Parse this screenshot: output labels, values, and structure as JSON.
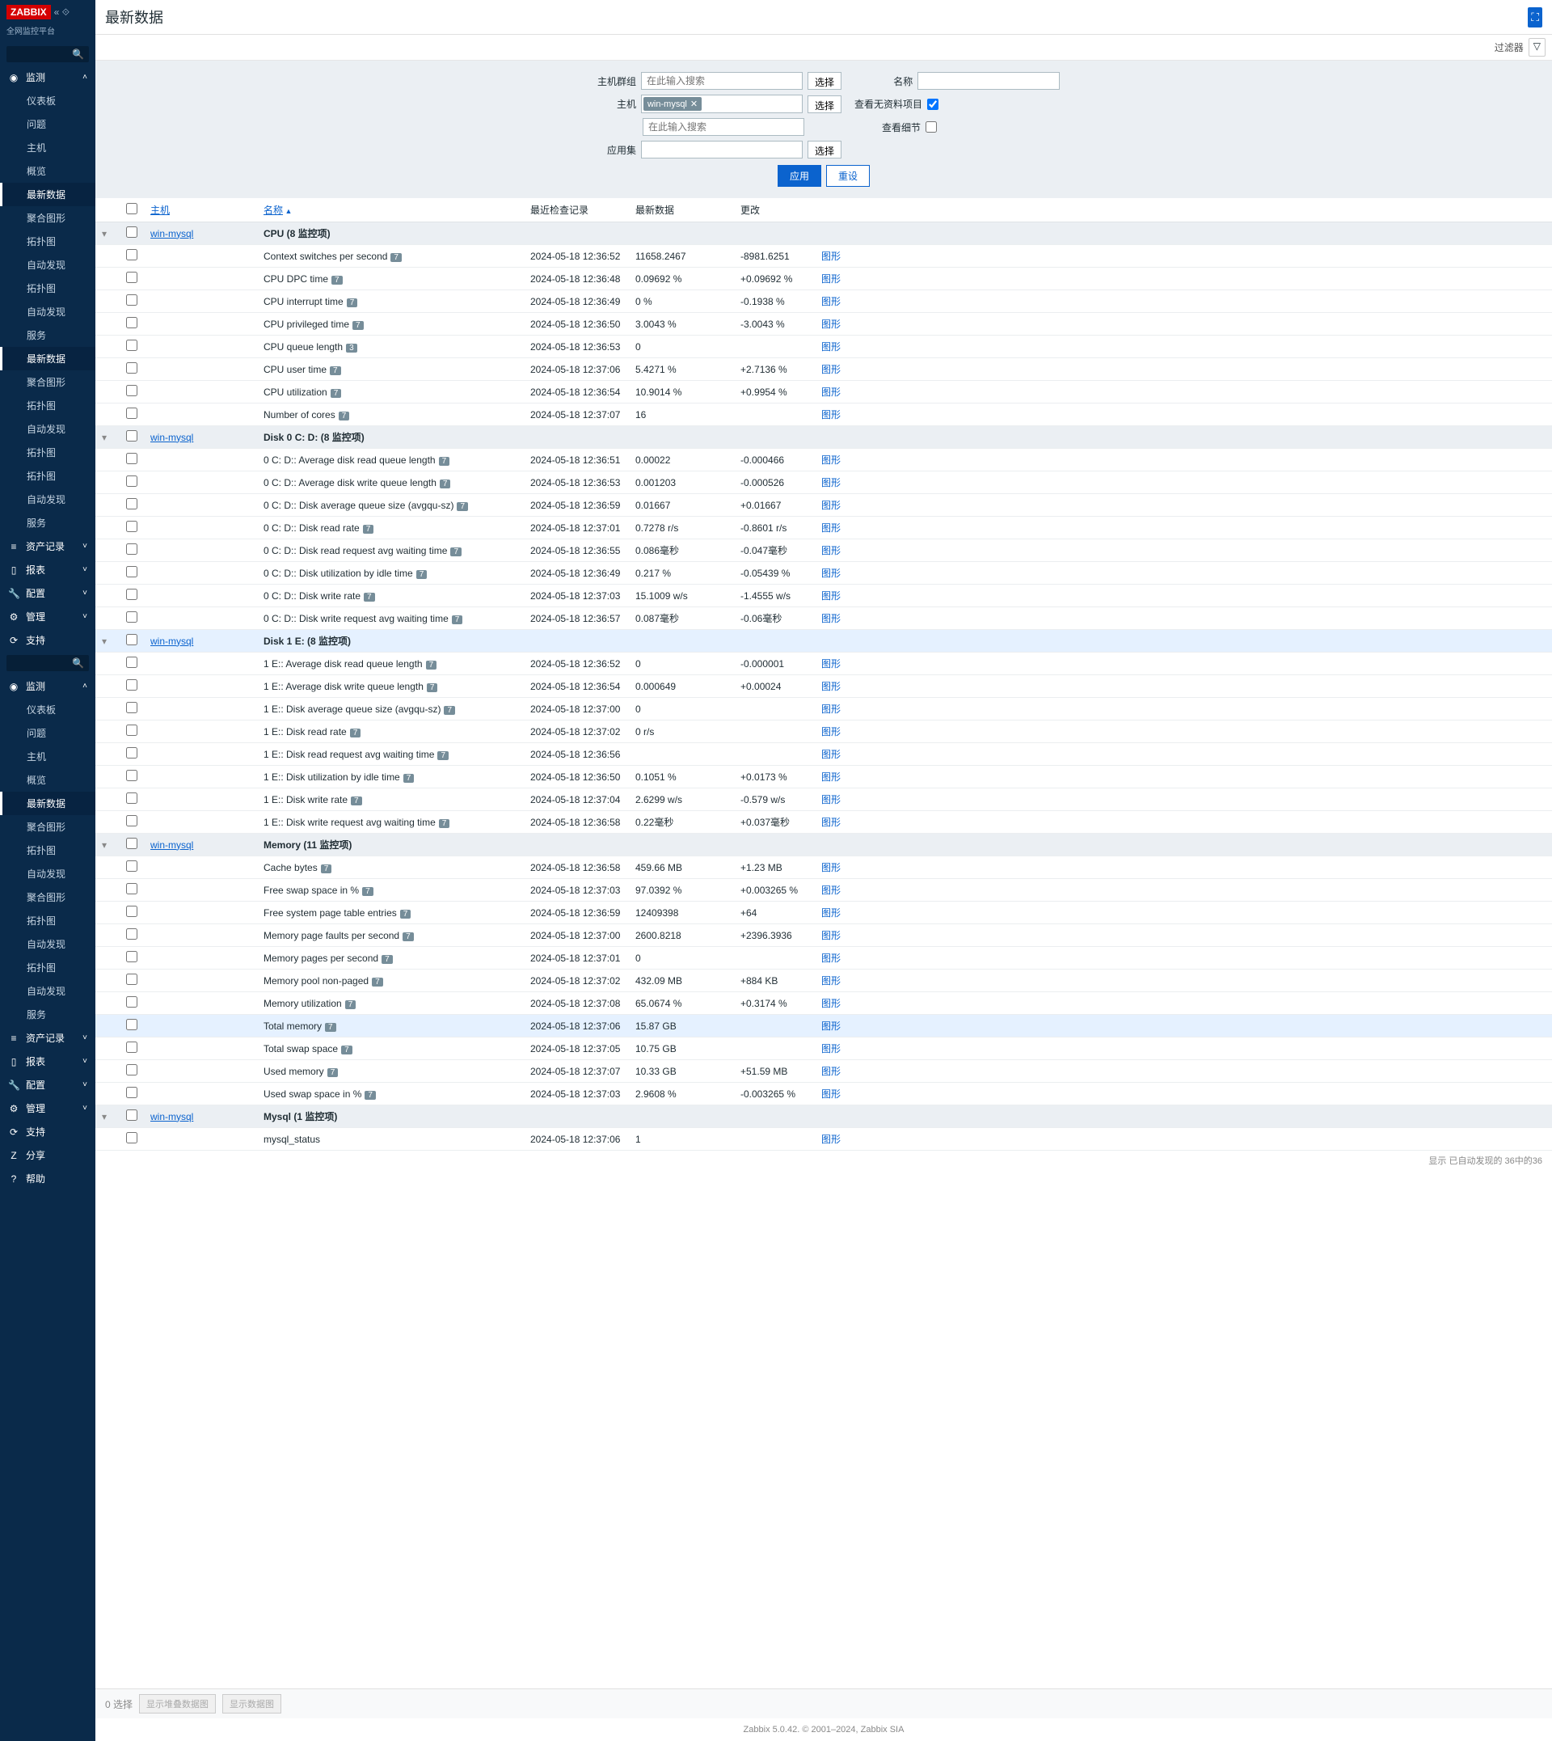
{
  "logo": "ZABBIX",
  "sublogo": "全网监控平台",
  "page_title": "最新数据",
  "filter_label": "过滤器",
  "nav": [
    {
      "type": "section",
      "icon": "◉",
      "label": "监测",
      "chev": "˄"
    },
    {
      "type": "item",
      "label": "仪表板"
    },
    {
      "type": "item",
      "label": "问题"
    },
    {
      "type": "item",
      "label": "主机"
    },
    {
      "type": "item",
      "label": "概览"
    },
    {
      "type": "item",
      "label": "最新数据",
      "active": true
    },
    {
      "type": "item",
      "label": "聚合图形"
    },
    {
      "type": "item",
      "label": "拓扑图"
    },
    {
      "type": "item",
      "label": "自动发现"
    },
    {
      "type": "item",
      "label": "拓扑图"
    },
    {
      "type": "item",
      "label": "自动发现"
    },
    {
      "type": "item",
      "label": "服务"
    },
    {
      "type": "item",
      "label": "最新数据",
      "active": true
    },
    {
      "type": "item",
      "label": "聚合图形"
    },
    {
      "type": "item",
      "label": "拓扑图"
    },
    {
      "type": "item",
      "label": "自动发现"
    },
    {
      "type": "item",
      "label": "拓扑图"
    },
    {
      "type": "item",
      "label": "拓扑图"
    },
    {
      "type": "item",
      "label": "自动发现"
    },
    {
      "type": "item",
      "label": "服务"
    },
    {
      "type": "section",
      "icon": "≡",
      "label": "资产记录",
      "chev": "˅"
    },
    {
      "type": "section",
      "icon": "▯",
      "label": "报表",
      "chev": "˅"
    },
    {
      "type": "section",
      "icon": "🔧",
      "label": "配置",
      "chev": "˅"
    },
    {
      "type": "section",
      "icon": "⚙",
      "label": "管理",
      "chev": "˅"
    },
    {
      "type": "section",
      "icon": "⟳",
      "label": "支持"
    },
    {
      "type": "search"
    },
    {
      "type": "section",
      "icon": "◉",
      "label": "监测",
      "chev": "˄"
    },
    {
      "type": "item",
      "label": "仪表板"
    },
    {
      "type": "item",
      "label": "问题"
    },
    {
      "type": "item",
      "label": "主机"
    },
    {
      "type": "item",
      "label": "概览"
    },
    {
      "type": "item",
      "label": "最新数据",
      "active": true
    },
    {
      "type": "item",
      "label": "聚合图形"
    },
    {
      "type": "item",
      "label": "拓扑图"
    },
    {
      "type": "item",
      "label": "自动发现"
    },
    {
      "type": "item",
      "label": "聚合图形"
    },
    {
      "type": "item",
      "label": "拓扑图"
    },
    {
      "type": "item",
      "label": "自动发现"
    },
    {
      "type": "item",
      "label": "拓扑图"
    },
    {
      "type": "item",
      "label": "自动发现"
    },
    {
      "type": "item",
      "label": "服务"
    },
    {
      "type": "section",
      "icon": "≡",
      "label": "资产记录",
      "chev": "˅"
    },
    {
      "type": "section",
      "icon": "▯",
      "label": "报表",
      "chev": "˅"
    },
    {
      "type": "section",
      "icon": "🔧",
      "label": "配置",
      "chev": "˅"
    },
    {
      "type": "section",
      "icon": "⚙",
      "label": "管理",
      "chev": "˅"
    },
    {
      "type": "section",
      "icon": "⟳",
      "label": "支持"
    },
    {
      "type": "section",
      "icon": "Z",
      "label": "分享"
    },
    {
      "type": "section",
      "icon": "?",
      "label": "帮助"
    }
  ],
  "filter": {
    "hostgroup_label": "主机群组",
    "hostgroup_placeholder": "在此输入搜索",
    "select": "选择",
    "host_label": "主机",
    "host_tag": "win-mysql",
    "host_placeholder": "在此输入搜索",
    "app_label": "应用集",
    "name_label": "名称",
    "nodata_label": "查看无资料项目",
    "nodata_checked": true,
    "detail_label": "查看细节",
    "detail_checked": false,
    "apply": "应用",
    "reset": "重设"
  },
  "cols": {
    "host": "主机",
    "name": "名称",
    "time": "最近检查记录",
    "last": "最新数据",
    "change": "更改"
  },
  "graph_label": "图形",
  "groups": [
    {
      "host": "win-mysql",
      "title": "CPU",
      "count": "(8 监控项)",
      "rows": [
        {
          "name": "Context switches per second",
          "b": "7",
          "time": "2024-05-18 12:36:52",
          "last": "11658.2467",
          "chg": "-8981.6251"
        },
        {
          "name": "CPU DPC time",
          "b": "7",
          "time": "2024-05-18 12:36:48",
          "last": "0.09692 %",
          "chg": "+0.09692 %"
        },
        {
          "name": "CPU interrupt time",
          "b": "7",
          "time": "2024-05-18 12:36:49",
          "last": "0 %",
          "chg": "-0.1938 %"
        },
        {
          "name": "CPU privileged time",
          "b": "7",
          "time": "2024-05-18 12:36:50",
          "last": "3.0043 %",
          "chg": "-3.0043 %"
        },
        {
          "name": "CPU queue length",
          "b": "3",
          "time": "2024-05-18 12:36:53",
          "last": "0",
          "chg": ""
        },
        {
          "name": "CPU user time",
          "b": "7",
          "time": "2024-05-18 12:37:06",
          "last": "5.4271 %",
          "chg": "+2.7136 %"
        },
        {
          "name": "CPU utilization",
          "b": "7",
          "time": "2024-05-18 12:36:54",
          "last": "10.9014 %",
          "chg": "+0.9954 %"
        },
        {
          "name": "Number of cores",
          "b": "7",
          "time": "2024-05-18 12:37:07",
          "last": "16",
          "chg": ""
        }
      ]
    },
    {
      "host": "win-mysql",
      "title": "Disk 0 C: D:",
      "count": "(8 监控项)",
      "rows": [
        {
          "name": "0 C: D:: Average disk read queue length",
          "b": "7",
          "time": "2024-05-18 12:36:51",
          "last": "0.00022",
          "chg": "-0.000466"
        },
        {
          "name": "0 C: D:: Average disk write queue length",
          "b": "7",
          "time": "2024-05-18 12:36:53",
          "last": "0.001203",
          "chg": "-0.000526"
        },
        {
          "name": "0 C: D:: Disk average queue size (avgqu-sz)",
          "b": "7",
          "time": "2024-05-18 12:36:59",
          "last": "0.01667",
          "chg": "+0.01667"
        },
        {
          "name": "0 C: D:: Disk read rate",
          "b": "7",
          "time": "2024-05-18 12:37:01",
          "last": "0.7278 r/s",
          "chg": "-0.8601 r/s"
        },
        {
          "name": "0 C: D:: Disk read request avg waiting time",
          "b": "7",
          "time": "2024-05-18 12:36:55",
          "last": "0.086毫秒",
          "chg": "-0.047毫秒"
        },
        {
          "name": "0 C: D:: Disk utilization by idle time",
          "b": "7",
          "time": "2024-05-18 12:36:49",
          "last": "0.217 %",
          "chg": "-0.05439 %"
        },
        {
          "name": "0 C: D:: Disk write rate",
          "b": "7",
          "time": "2024-05-18 12:37:03",
          "last": "15.1009 w/s",
          "chg": "-1.4555 w/s"
        },
        {
          "name": "0 C: D:: Disk write request avg waiting time",
          "b": "7",
          "time": "2024-05-18 12:36:57",
          "last": "0.087毫秒",
          "chg": "-0.06毫秒"
        }
      ]
    },
    {
      "host": "win-mysql",
      "title": "Disk 1 E:",
      "count": "(8 监控项)",
      "hl": true,
      "rows": [
        {
          "name": "1 E:: Average disk read queue length",
          "b": "7",
          "time": "2024-05-18 12:36:52",
          "last": "0",
          "chg": "-0.000001"
        },
        {
          "name": "1 E:: Average disk write queue length",
          "b": "7",
          "time": "2024-05-18 12:36:54",
          "last": "0.000649",
          "chg": "+0.00024"
        },
        {
          "name": "1 E:: Disk average queue size (avgqu-sz)",
          "b": "7",
          "time": "2024-05-18 12:37:00",
          "last": "0",
          "chg": ""
        },
        {
          "name": "1 E:: Disk read rate",
          "b": "7",
          "time": "2024-05-18 12:37:02",
          "last": "0 r/s",
          "chg": ""
        },
        {
          "name": "1 E:: Disk read request avg waiting time",
          "b": "7",
          "time": "2024-05-18 12:36:56",
          "last": "",
          "chg": ""
        },
        {
          "name": "1 E:: Disk utilization by idle time",
          "b": "7",
          "time": "2024-05-18 12:36:50",
          "last": "0.1051 %",
          "chg": "+0.0173 %"
        },
        {
          "name": "1 E:: Disk write rate",
          "b": "7",
          "time": "2024-05-18 12:37:04",
          "last": "2.6299 w/s",
          "chg": "-0.579 w/s"
        },
        {
          "name": "1 E:: Disk write request avg waiting time",
          "b": "7",
          "time": "2024-05-18 12:36:58",
          "last": "0.22毫秒",
          "chg": "+0.037毫秒"
        }
      ]
    },
    {
      "host": "win-mysql",
      "title": "Memory",
      "count": "(11 监控项)",
      "rows": [
        {
          "name": "Cache bytes",
          "b": "7",
          "time": "2024-05-18 12:36:58",
          "last": "459.66 MB",
          "chg": "+1.23 MB"
        },
        {
          "name": "Free swap space in %",
          "b": "7",
          "time": "2024-05-18 12:37:03",
          "last": "97.0392 %",
          "chg": "+0.003265 %"
        },
        {
          "name": "Free system page table entries",
          "b": "7",
          "time": "2024-05-18 12:36:59",
          "last": "12409398",
          "chg": "+64"
        },
        {
          "name": "Memory page faults per second",
          "b": "7",
          "time": "2024-05-18 12:37:00",
          "last": "2600.8218",
          "chg": "+2396.3936"
        },
        {
          "name": "Memory pages per second",
          "b": "7",
          "time": "2024-05-18 12:37:01",
          "last": "0",
          "chg": ""
        },
        {
          "name": "Memory pool non-paged",
          "b": "7",
          "time": "2024-05-18 12:37:02",
          "last": "432.09 MB",
          "chg": "+884 KB"
        },
        {
          "name": "Memory utilization",
          "b": "7",
          "time": "2024-05-18 12:37:08",
          "last": "65.0674 %",
          "chg": "+0.3174 %"
        },
        {
          "name": "Total memory",
          "b": "7",
          "time": "2024-05-18 12:37:06",
          "last": "15.87 GB",
          "chg": "",
          "hl": true
        },
        {
          "name": "Total swap space",
          "b": "7",
          "time": "2024-05-18 12:37:05",
          "last": "10.75 GB",
          "chg": ""
        },
        {
          "name": "Used memory",
          "b": "7",
          "time": "2024-05-18 12:37:07",
          "last": "10.33 GB",
          "chg": "+51.59 MB"
        },
        {
          "name": "Used swap space in %",
          "b": "7",
          "time": "2024-05-18 12:37:03",
          "last": "2.9608 %",
          "chg": "-0.003265 %"
        }
      ]
    },
    {
      "host": "win-mysql",
      "title": "Mysql",
      "count": "(1 监控项)",
      "rows": [
        {
          "name": "mysql_status",
          "b": "",
          "time": "2024-05-18 12:37:06",
          "last": "1",
          "chg": ""
        }
      ]
    }
  ],
  "footer": {
    "selected": "0 选择",
    "btn1": "显示堆叠数据图",
    "btn2": "显示数据图",
    "count": "显示 已自动发现的 36中的36",
    "version": "Zabbix 5.0.42. © 2001–2024, Zabbix SIA"
  }
}
